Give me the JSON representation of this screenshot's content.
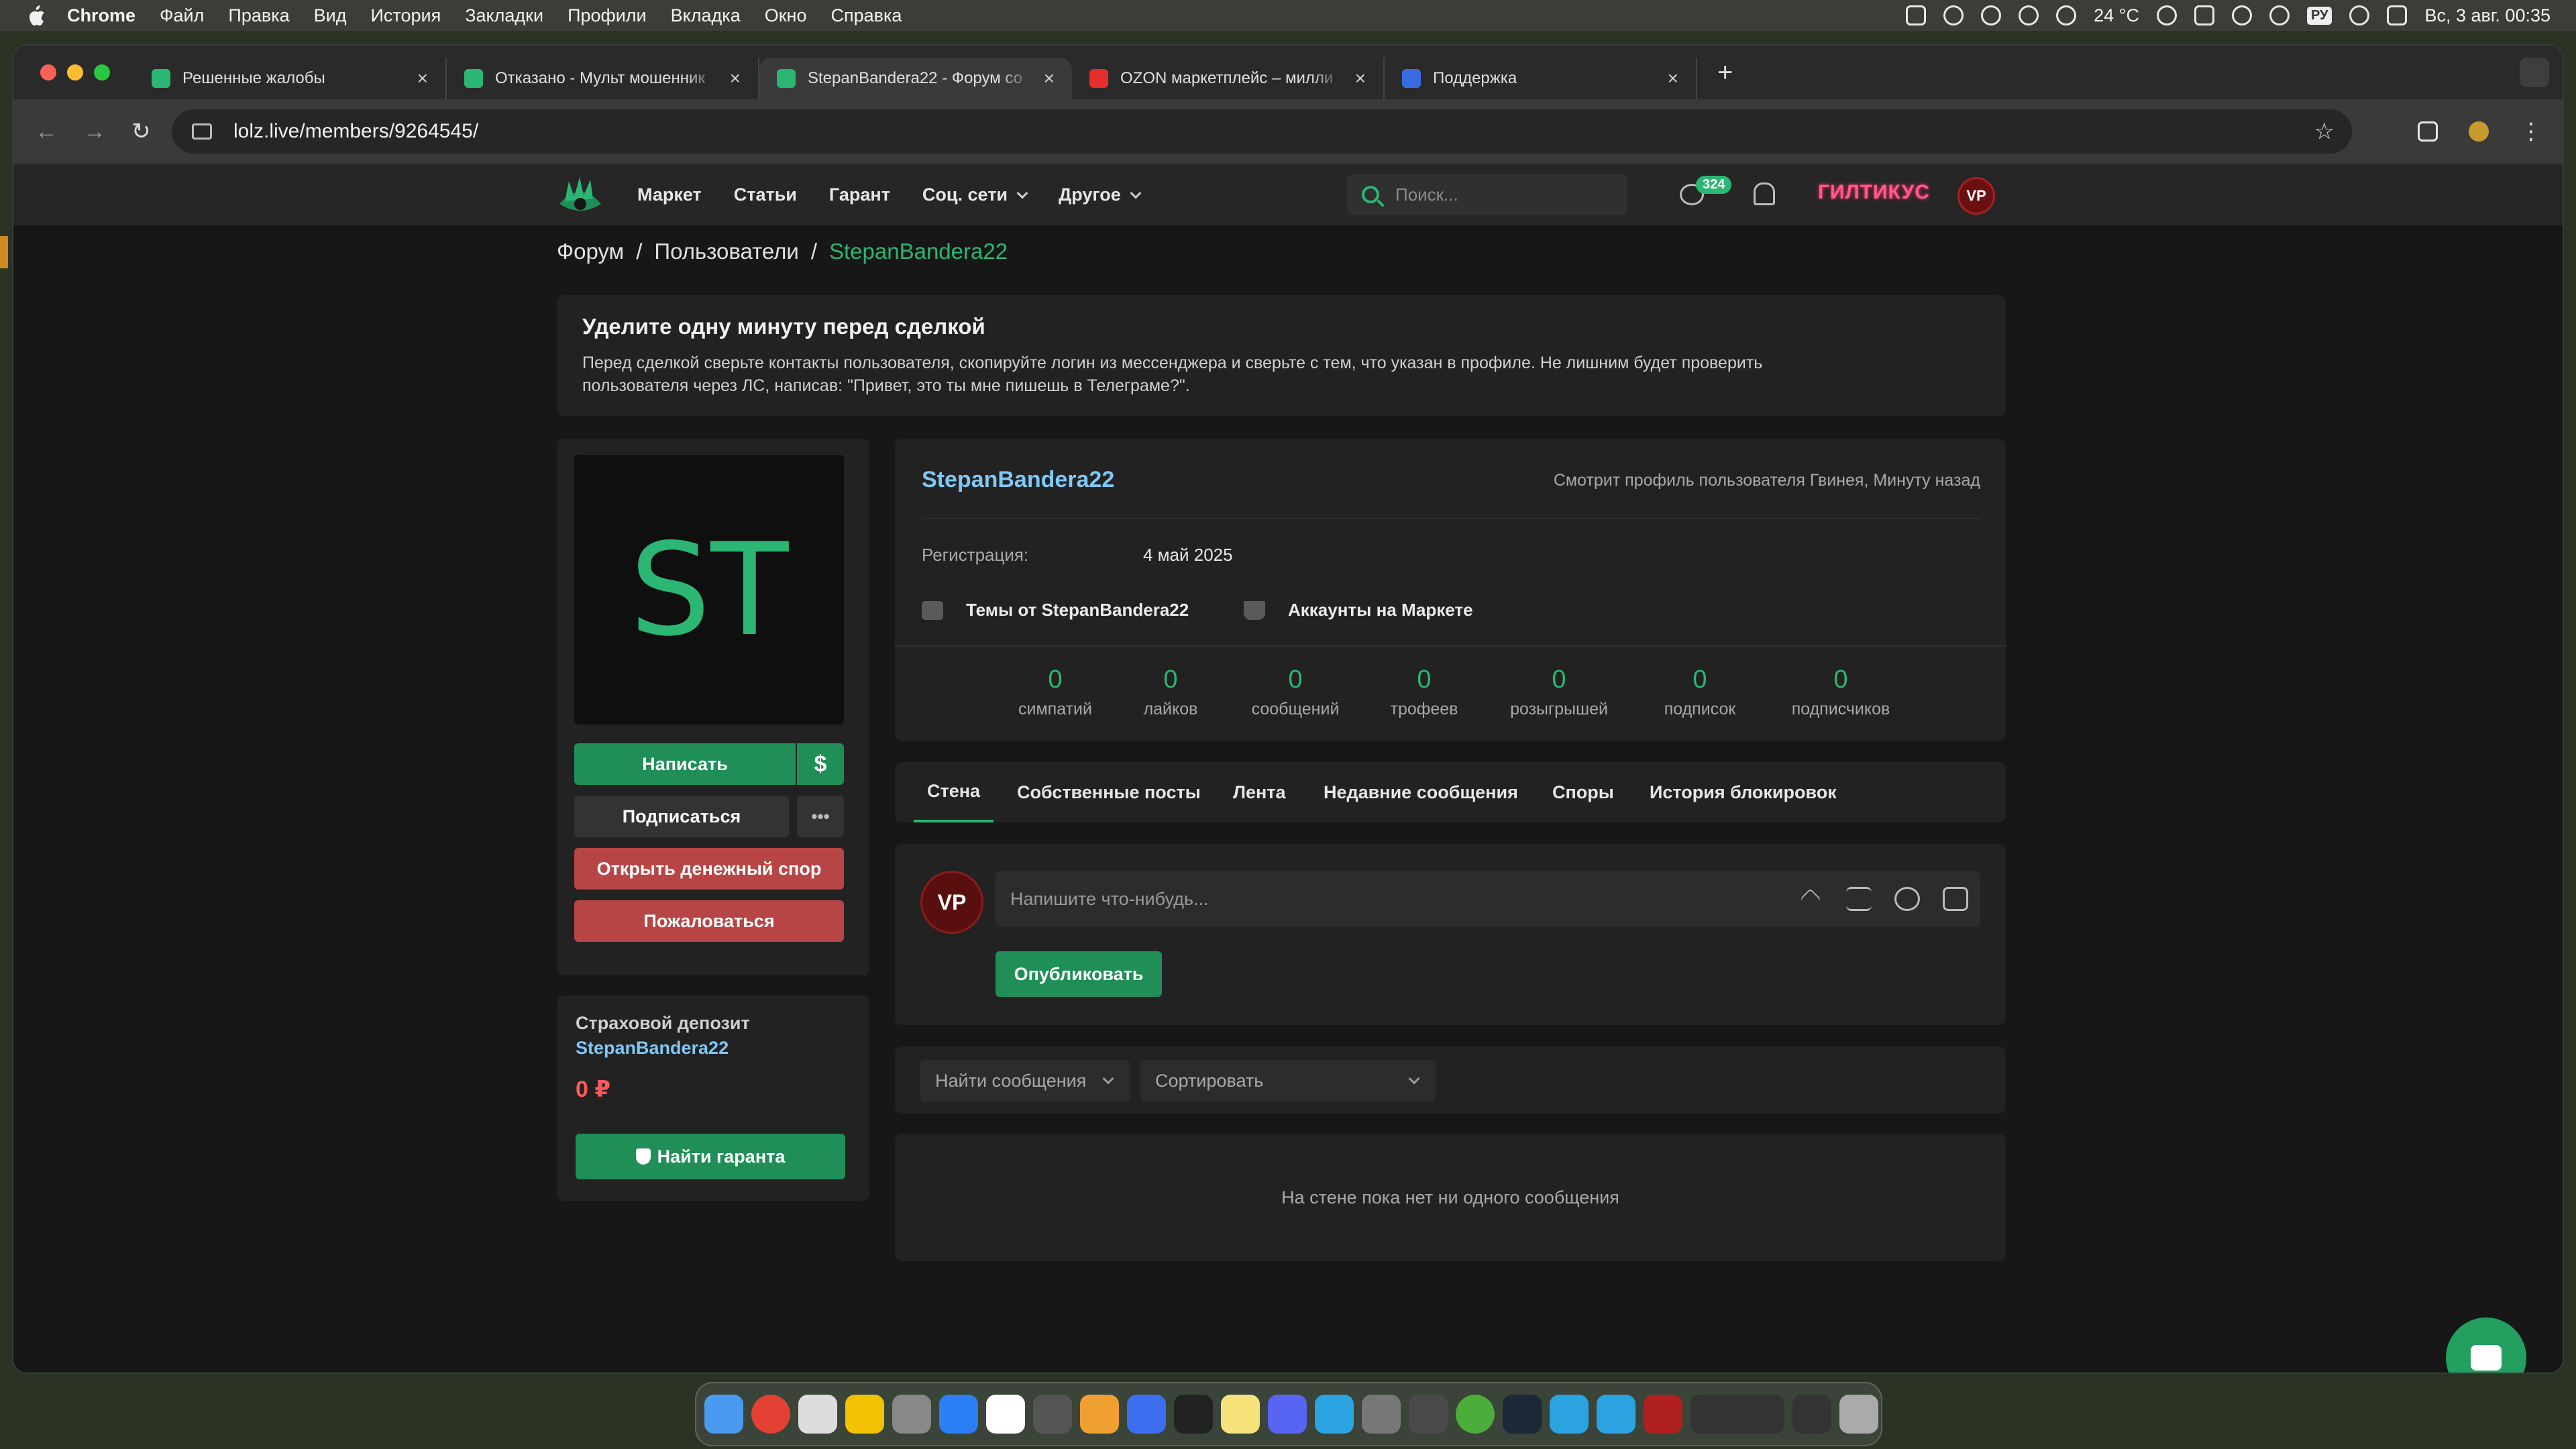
{
  "macbar": {
    "app": "Chrome",
    "menu": [
      "Файл",
      "Правка",
      "Вид",
      "История",
      "Закладки",
      "Профили",
      "Вкладка",
      "Окно",
      "Справка"
    ],
    "weather": "24 °C",
    "lang": "РУ",
    "datetime": "Вс, 3 авг. 00:35"
  },
  "browser": {
    "tabs": [
      {
        "title": "Решенные жалобы",
        "fav": "#2bb673"
      },
      {
        "title": "Отказано - Мульт мошенник",
        "fav": "#2bb673"
      },
      {
        "title": "StepanBandera22 - Форум со",
        "fav": "#2bb673"
      },
      {
        "title": "OZON маркетплейс – милли",
        "fav": "#e52d2d"
      },
      {
        "title": "Поддержка",
        "fav": "#3a6be0"
      }
    ],
    "active_tab": 2,
    "url": "lolz.live/members/9264545/"
  },
  "site": {
    "nav": [
      "Маркет",
      "Статьи",
      "Гарант",
      "Соц. сети",
      "Другое"
    ],
    "search_placeholder": "Поиск...",
    "messages_badge": "324",
    "username": "ГИЛТИКУС",
    "user_avatar": "VP"
  },
  "breadcrumb": {
    "items": [
      "Форум",
      "Пользователи"
    ],
    "current": "StepanBandera22",
    "sep": "/"
  },
  "warning": {
    "title": "Уделите одну минуту перед сделкой",
    "line1": "Перед сделкой сверьте контакты пользователя, скопируйте логин из мессенджера и сверьте с тем, что указан в профиле. Не лишним будет проверить",
    "line2": "пользователя через ЛС, написав: \"Привет, это ты мне пишешь в Телеграме?\"."
  },
  "sidebar": {
    "avatar_initials": "ST",
    "write_button": "Написать",
    "money_icon": "$",
    "subscribe_button": "Подписаться",
    "more_icon": "•••",
    "dispute_button": "Открыть денежный спор",
    "report_button": "Пожаловаться",
    "deposit_label": "Страховой депозит",
    "deposit_user": "StepanBandera22",
    "deposit_amount": "0 ₽",
    "guarantor_button": "Найти гаранта"
  },
  "profile": {
    "name": "StepanBandera22",
    "viewing": "Смотрит профиль пользователя Гвинея, Минуту назад",
    "reg_label": "Регистрация:",
    "reg_value": "4 май 2025",
    "topics_link": "Темы от StepanBandera22",
    "market_link": "Аккаунты на Маркете",
    "stats": [
      {
        "value": "0",
        "label": "симпатий"
      },
      {
        "value": "0",
        "label": "лайков"
      },
      {
        "value": "0",
        "label": "сообщений"
      },
      {
        "value": "0",
        "label": "трофеев"
      },
      {
        "value": "0",
        "label": "розыгрышей"
      },
      {
        "value": "0",
        "label": "подписок"
      },
      {
        "value": "0",
        "label": "подписчиков"
      }
    ]
  },
  "tabs": [
    "Стена",
    "Собственные посты",
    "Лента",
    "Недавние сообщения",
    "Споры",
    "История блокировок"
  ],
  "composer": {
    "avatar": "VP",
    "placeholder": "Напишите что-нибудь...",
    "publish": "Опубликовать"
  },
  "filters": {
    "find": "Найти сообщения",
    "sort": "Сортировать"
  },
  "wall_empty": "На стене пока нет ни одного сообщения",
  "colors": {
    "accent": "#2bb673",
    "link": "#7fc8f8",
    "danger": "#b84545",
    "amount": "#ff5a5a"
  }
}
